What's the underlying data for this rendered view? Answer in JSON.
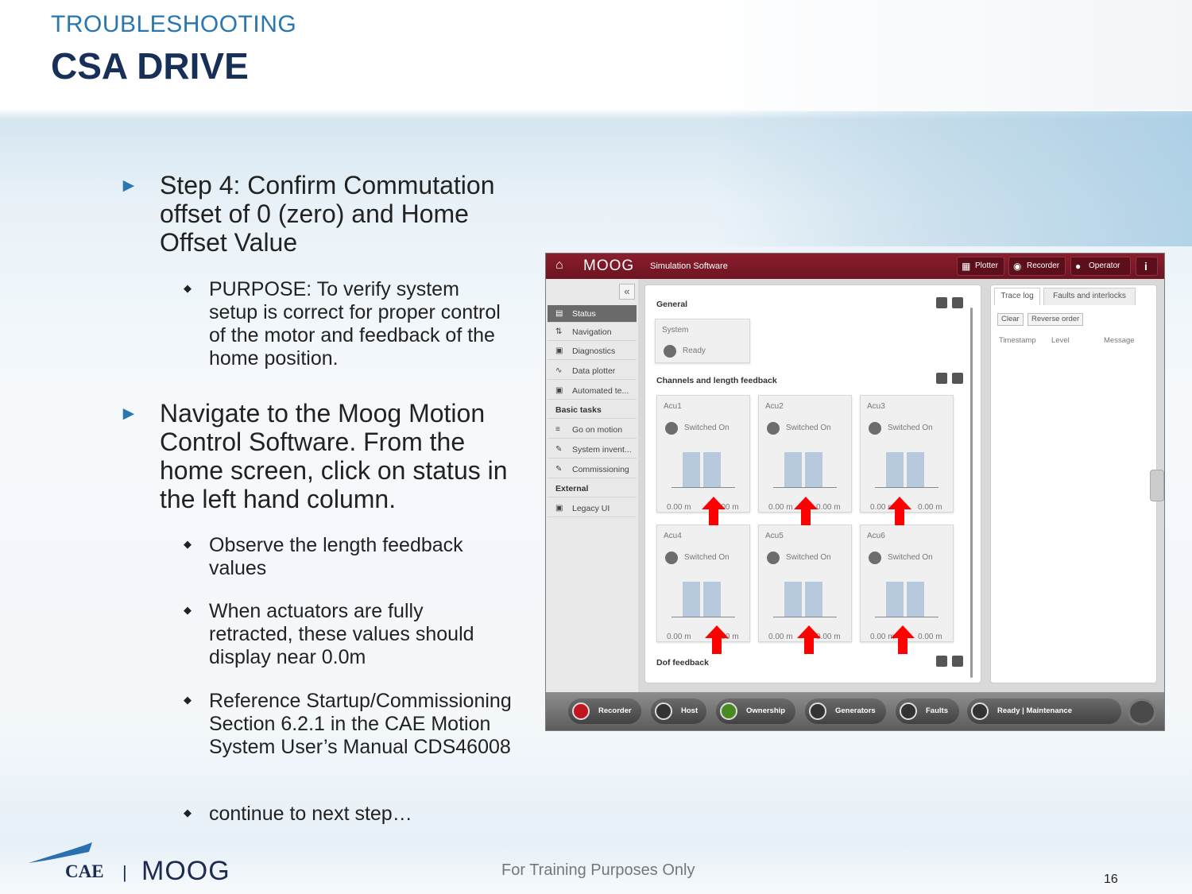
{
  "header": {
    "kicker": "TROUBLESHOOTING",
    "title": "CSA DRIVE"
  },
  "content": {
    "step4": "Step 4: Confirm Commutation offset of 0 (zero) and Home Offset Value",
    "purpose": "PURPOSE: To verify system setup is correct for proper control of the motor and feedback of the home position.",
    "navigate": "Navigate to the Moog Motion Control Software. From the home screen, click on status in the left hand column.",
    "sub_bullets": [
      "Observe the length feedback values",
      "When actuators are fully retracted, these values should display near 0.0m",
      "Reference Startup/Commissioning Section 6.2.1 in the CAE Motion System User’s Manual CDS46008",
      "continue to next step…"
    ]
  },
  "app": {
    "logo": "MOOG",
    "subtitle": "Simulation Software",
    "top_buttons": [
      "Plotter",
      "Recorder",
      "Operator"
    ],
    "info_icon": "i",
    "sidebar": {
      "items": [
        "Status",
        "Navigation",
        "Diagnostics",
        "Data plotter",
        "Automated te..."
      ],
      "basic_tasks_header": "Basic tasks",
      "basic_tasks": [
        "Go on motion",
        "System invent...",
        "Commissioning"
      ],
      "external_header": "External",
      "external": [
        "Legacy UI"
      ]
    },
    "main": {
      "general_title": "General",
      "system_label": "System",
      "system_status": "Ready",
      "channels_title": "Channels and length feedback",
      "dof_title": "Dof feedback",
      "actuators": [
        {
          "name": "Acu1",
          "status": "Switched On",
          "left": "0.00 m",
          "right": "0.00 m"
        },
        {
          "name": "Acu2",
          "status": "Switched On",
          "left": "0.00 m",
          "right": "0.00 m"
        },
        {
          "name": "Acu3",
          "status": "Switched On",
          "left": "0.00 m",
          "right": "0.00 m"
        },
        {
          "name": "Acu4",
          "status": "Switched On",
          "left": "0.00 m",
          "right": "0.00 m"
        },
        {
          "name": "Acu5",
          "status": "Switched On",
          "left": "0.00 m",
          "right": "0.00 m"
        },
        {
          "name": "Acu6",
          "status": "Switched On",
          "left": "0.00 m",
          "right": "0.00 m"
        }
      ]
    },
    "right_panel": {
      "tabs": [
        "Trace log",
        "Faults and interlocks"
      ],
      "buttons": [
        "Clear",
        "Reverse order"
      ],
      "columns": [
        "Timestamp",
        "Level",
        "Message"
      ]
    },
    "bottom_bar": [
      "Recorder",
      "Host",
      "Ownership",
      "Generators",
      "Faults",
      "Ready | Maintenance"
    ]
  },
  "footer": {
    "note": "For Training Purposes Only",
    "page": "16",
    "logo_cae": "CAE",
    "logo_sep": "|",
    "logo_moog": "MOOG"
  },
  "colors": {
    "title": "#182f57",
    "kicker": "#2a76ae",
    "app_topbar": "#8b1d2c",
    "arrow": "#ff0000"
  }
}
